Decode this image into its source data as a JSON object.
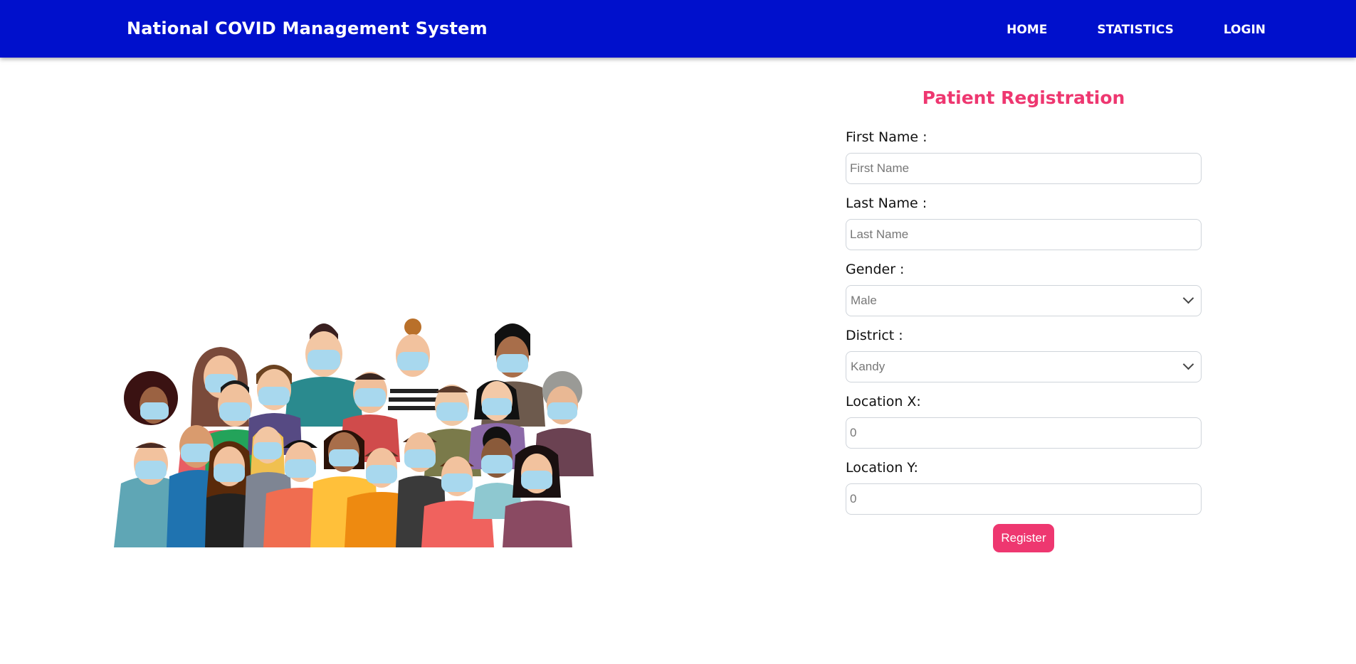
{
  "navbar": {
    "brand": "National COVID Management System",
    "links": [
      "HOME",
      "STATISTICS",
      "LOGIN"
    ]
  },
  "form": {
    "title": "Patient Registration",
    "first_name_label": "First Name :",
    "first_name_placeholder": "First Name",
    "last_name_label": "Last Name :",
    "last_name_placeholder": "Last Name",
    "gender_label": "Gender :",
    "gender_value": "Male",
    "district_label": "District :",
    "district_value": "Kandy",
    "location_x_label": "Location X:",
    "location_x_value": "0",
    "location_y_label": "Location Y:",
    "location_y_value": "0",
    "register_label": "Register"
  },
  "colors": {
    "navbar": "#0010cc",
    "accent": "#ee3770"
  }
}
